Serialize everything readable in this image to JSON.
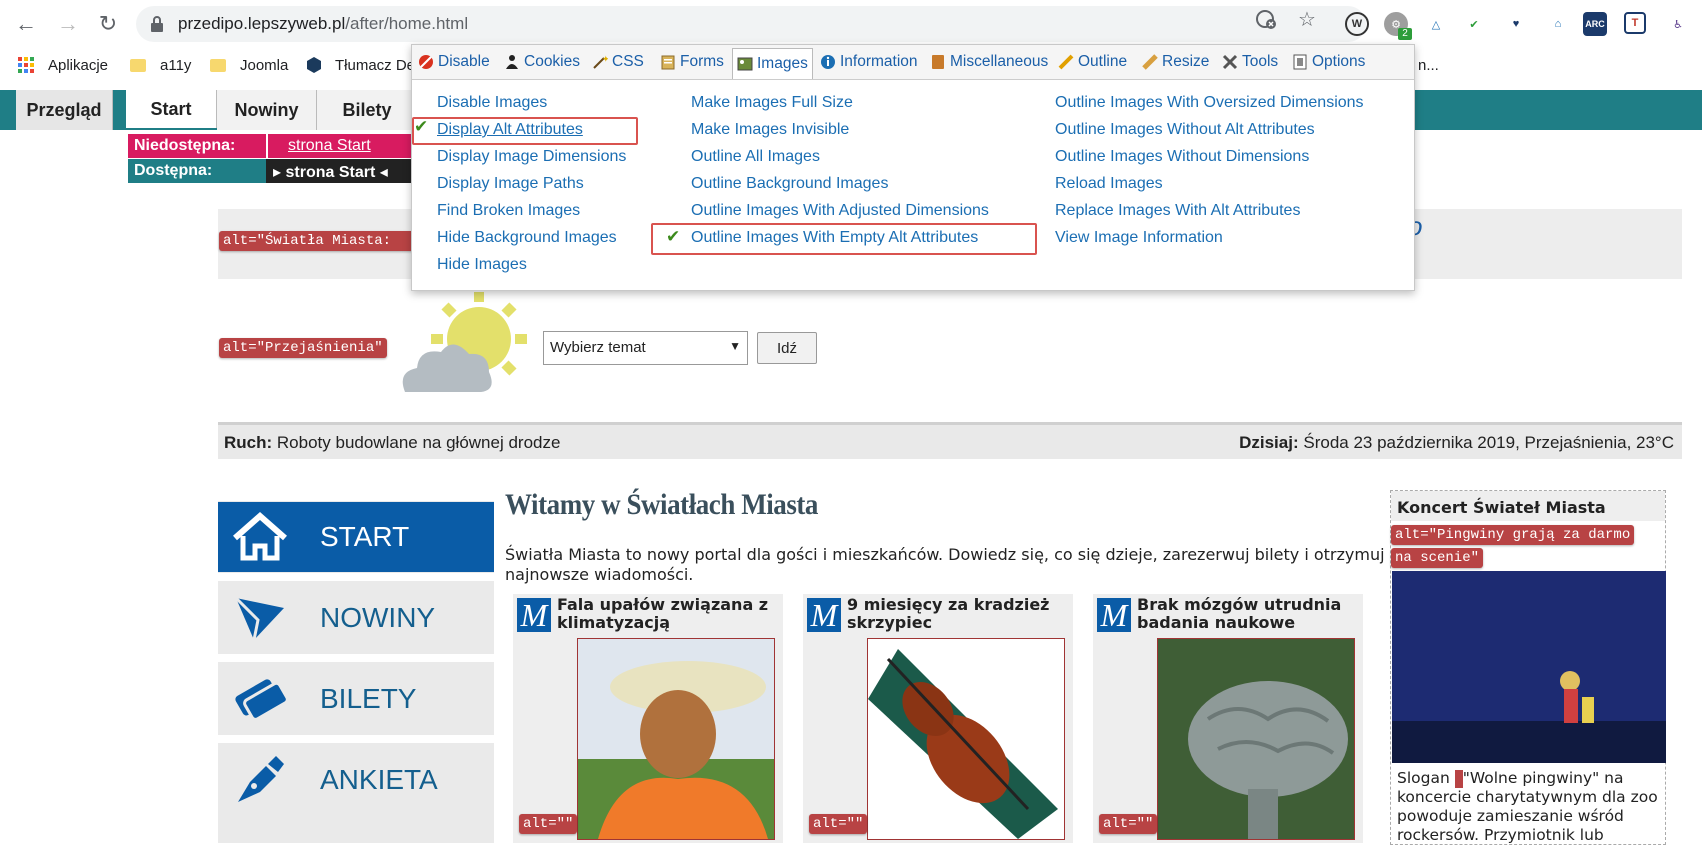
{
  "browser": {
    "url_host": "przedipo.lepszyweb.pl",
    "url_path": "/after/home.html",
    "extension_badge": "2",
    "ext_labels": [
      "W",
      "ARC"
    ]
  },
  "bookmarks": {
    "apps": "Aplikacje",
    "items": [
      "a11y",
      "Joomla",
      "Tłumacz De"
    ],
    "more": "n..."
  },
  "pagenav": {
    "tabs": [
      "Przegląd",
      "Start",
      "Nowiny",
      "Bilety"
    ]
  },
  "skip": {
    "unavailable_label": "Niedostępna:",
    "unavailable_value": "strona Start",
    "available_label": "Dostępna:",
    "available_value": "strona Start"
  },
  "page": {
    "banner_alt": "alt=\"Światła Miasta: ",
    "weather_alt": "alt=\"Przejaśnienia\"",
    "select_value": "Wybierz temat",
    "go_button": "Idź",
    "traffic_label": "Ruch:",
    "traffic_text": "Roboty budowlane na głównej drodze",
    "today_label": "Dzisiaj:",
    "today_text": "Środa 23 października 2019, Przejaśnienia, 23°C",
    "leftnav": [
      "START",
      "NOWINY",
      "BILETY",
      "ANKIETA"
    ],
    "title": "Witamy w Światłach Miasta",
    "intro": "Światła Miasta to nowy portal dla gości i mieszkańców. Dowiedz się, co się dzieje, zarezerwuj bilety i otrzymuj najnowsze wiadomości.",
    "cards": [
      {
        "title": "Fala upałów związana z klimatyzacją",
        "alt": "alt=\"\""
      },
      {
        "title": "9 miesięcy za kradzież skrzypiec",
        "alt": "alt=\"\""
      },
      {
        "title": "Brak mózgów utrudnia badania naukowe",
        "alt": "alt=\"\""
      }
    ],
    "side": {
      "title": "Koncert Świateł Miasta",
      "alt_line1": "alt=\"Pingwiny grają za darmo",
      "alt_line2": "na scenie\"",
      "body_pre": "Slogan ",
      "body_post": "\"Wolne pingwiny\" na koncercie charytatywnym dla zoo powoduje zamieszanie wśród rockersów. Przymiotnik lub"
    }
  },
  "webdev": {
    "tabs": [
      "Disable",
      "Cookies",
      "CSS",
      "Forms",
      "Images",
      "Information",
      "Miscellaneous",
      "Outline",
      "Resize",
      "Tools",
      "Options"
    ],
    "col1": [
      "Disable Images",
      "Display Alt Attributes",
      "Display Image Dimensions",
      "Display Image Paths",
      "Find Broken Images",
      "Hide Background Images",
      "Hide Images"
    ],
    "col2": [
      "Make Images Full Size",
      "Make Images Invisible",
      "Outline All Images",
      "Outline Background Images",
      "Outline Images With Adjusted Dimensions",
      "Outline Images With Empty Alt Attributes"
    ],
    "col3": [
      "Outline Images With Oversized Dimensions",
      "Outline Images Without Alt Attributes",
      "Outline Images Without Dimensions",
      "Reload Images",
      "Replace Images With Alt Attributes",
      "View Image Information"
    ]
  }
}
